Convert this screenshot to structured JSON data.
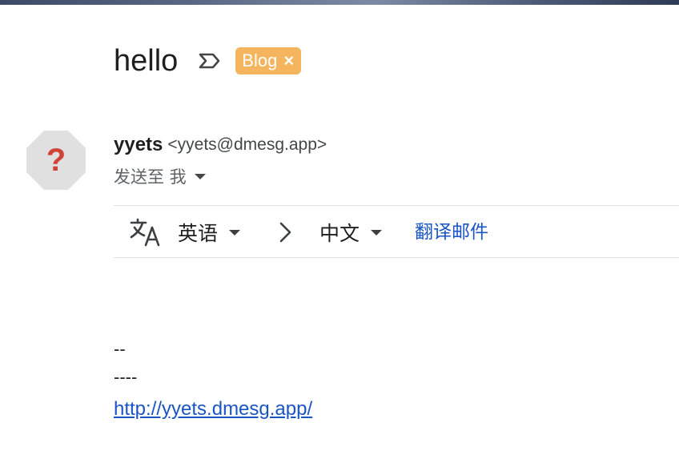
{
  "subject": "hello",
  "label": {
    "name": "Blog",
    "remove": "×",
    "color": "#f5b55f"
  },
  "importance_icon": "importance-marker-icon",
  "sender": {
    "avatar_icon": "unknown-sender-icon",
    "avatar_glyph": "?",
    "name": "yyets",
    "email": "<yyets@dmesg.app>"
  },
  "recipient": {
    "text": "发送至 我"
  },
  "translate": {
    "icon": "translate-icon",
    "source_lang": "英语",
    "target_lang": "中文",
    "action": "翻译邮件",
    "link_color": "#1a55c4"
  },
  "body": {
    "line1": "--",
    "line2": "----",
    "link": "http://yyets.dmesg.app/"
  }
}
